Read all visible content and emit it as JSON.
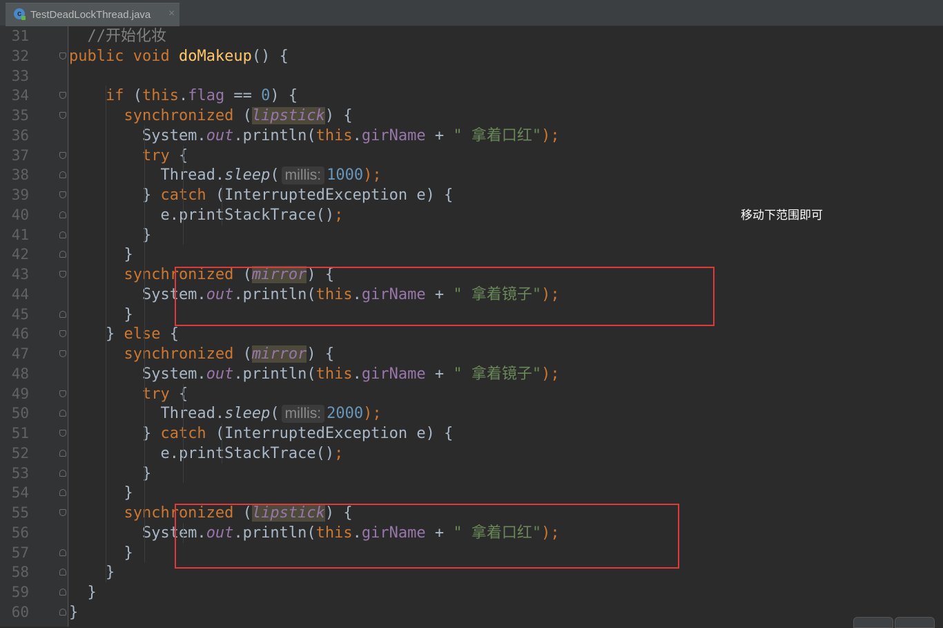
{
  "tab": {
    "filename": "TestDeadLockThread.java",
    "close_glyph": "×",
    "icon_letter": "c"
  },
  "annotation": "移动下范围即可",
  "lines": [
    {
      "n": "31",
      "parts": [
        [
          "  //开始化妆",
          "cmt"
        ]
      ]
    },
    {
      "n": "32",
      "parts": [
        [
          "public ",
          "kw"
        ],
        [
          "void ",
          "kw"
        ],
        [
          "doMakeup",
          "fn"
        ],
        [
          "() {",
          ""
        ]
      ]
    },
    {
      "n": "33",
      "parts": []
    },
    {
      "n": "34",
      "parts": [
        [
          "    if ",
          "kw"
        ],
        [
          "(",
          ""
        ],
        [
          "this",
          "kw"
        ],
        [
          ".",
          ""
        ],
        [
          "flag",
          "fld"
        ],
        [
          " == ",
          ""
        ],
        [
          "0",
          "num"
        ],
        [
          ") {",
          ""
        ]
      ]
    },
    {
      "n": "35",
      "parts": [
        [
          "      synchronized ",
          "kw"
        ],
        [
          "(",
          ""
        ],
        [
          "lipstick",
          "lock"
        ],
        [
          ") {",
          ""
        ]
      ]
    },
    {
      "n": "36",
      "parts": [
        [
          "        System.",
          ""
        ],
        [
          "out",
          "fld ital"
        ],
        [
          ".println(",
          ""
        ],
        [
          "this",
          "kw"
        ],
        [
          ".",
          ""
        ],
        [
          "girName",
          "fld"
        ],
        [
          " + ",
          ""
        ],
        [
          "\" 拿着口红\"",
          "str"
        ],
        [
          ");",
          "kw"
        ]
      ]
    },
    {
      "n": "37",
      "parts": [
        [
          "        try ",
          "kw"
        ],
        [
          "{",
          ""
        ]
      ]
    },
    {
      "n": "38",
      "parts": [
        [
          "          Thread.",
          ""
        ],
        [
          "sleep",
          "ital"
        ],
        [
          "(",
          ""
        ],
        [
          "millis:",
          "hint"
        ],
        [
          "1000",
          "num"
        ],
        [
          ");",
          "kw"
        ]
      ]
    },
    {
      "n": "39",
      "parts": [
        [
          "        } ",
          ""
        ],
        [
          "catch ",
          "kw"
        ],
        [
          "(InterruptedException e) {",
          ""
        ]
      ]
    },
    {
      "n": "40",
      "parts": [
        [
          "          e.printStackTrace()",
          ""
        ],
        [
          ";",
          "kw"
        ]
      ]
    },
    {
      "n": "41",
      "parts": [
        [
          "        }",
          ""
        ]
      ]
    },
    {
      "n": "42",
      "parts": [
        [
          "      }",
          ""
        ]
      ]
    },
    {
      "n": "43",
      "parts": [
        [
          "      synchronized ",
          "kw"
        ],
        [
          "(",
          ""
        ],
        [
          "mirror",
          "lock"
        ],
        [
          ") {",
          ""
        ]
      ]
    },
    {
      "n": "44",
      "parts": [
        [
          "        System.",
          ""
        ],
        [
          "out",
          "fld ital"
        ],
        [
          ".println(",
          ""
        ],
        [
          "this",
          "kw"
        ],
        [
          ".",
          ""
        ],
        [
          "girName",
          "fld"
        ],
        [
          " + ",
          ""
        ],
        [
          "\" 拿着镜子\"",
          "str"
        ],
        [
          ");",
          "kw"
        ]
      ]
    },
    {
      "n": "45",
      "parts": [
        [
          "      }",
          ""
        ]
      ]
    },
    {
      "n": "46",
      "parts": [
        [
          "    } ",
          ""
        ],
        [
          "else ",
          "kw"
        ],
        [
          "{",
          ""
        ]
      ]
    },
    {
      "n": "47",
      "parts": [
        [
          "      synchronized ",
          "kw"
        ],
        [
          "(",
          ""
        ],
        [
          "mirror",
          "lock"
        ],
        [
          ") {",
          ""
        ]
      ]
    },
    {
      "n": "48",
      "parts": [
        [
          "        System.",
          ""
        ],
        [
          "out",
          "fld ital"
        ],
        [
          ".println(",
          ""
        ],
        [
          "this",
          "kw"
        ],
        [
          ".",
          ""
        ],
        [
          "girName",
          "fld"
        ],
        [
          " + ",
          ""
        ],
        [
          "\" 拿着镜子\"",
          "str"
        ],
        [
          ");",
          "kw"
        ]
      ]
    },
    {
      "n": "49",
      "parts": [
        [
          "        try ",
          "kw"
        ],
        [
          "{",
          ""
        ]
      ]
    },
    {
      "n": "50",
      "parts": [
        [
          "          Thread.",
          ""
        ],
        [
          "sleep",
          "ital"
        ],
        [
          "(",
          ""
        ],
        [
          "millis:",
          "hint"
        ],
        [
          "2000",
          "num"
        ],
        [
          ");",
          "kw"
        ]
      ]
    },
    {
      "n": "51",
      "parts": [
        [
          "        } ",
          ""
        ],
        [
          "catch ",
          "kw"
        ],
        [
          "(InterruptedException e) {",
          ""
        ]
      ]
    },
    {
      "n": "52",
      "parts": [
        [
          "          e.printStackTrace()",
          ""
        ],
        [
          ";",
          "kw"
        ]
      ]
    },
    {
      "n": "53",
      "parts": [
        [
          "        }",
          ""
        ]
      ]
    },
    {
      "n": "54",
      "parts": [
        [
          "      }",
          ""
        ]
      ]
    },
    {
      "n": "55",
      "parts": [
        [
          "      synchronized ",
          "kw"
        ],
        [
          "(",
          ""
        ],
        [
          "lipstick",
          "lock"
        ],
        [
          ") {",
          ""
        ]
      ]
    },
    {
      "n": "56",
      "parts": [
        [
          "        System.",
          ""
        ],
        [
          "out",
          "fld ital"
        ],
        [
          ".println(",
          ""
        ],
        [
          "this",
          "kw"
        ],
        [
          ".",
          ""
        ],
        [
          "girName",
          "fld"
        ],
        [
          " + ",
          ""
        ],
        [
          "\" 拿着口红\"",
          "str"
        ],
        [
          ");",
          "kw"
        ]
      ]
    },
    {
      "n": "57",
      "parts": [
        [
          "      }",
          ""
        ]
      ]
    },
    {
      "n": "58",
      "parts": [
        [
          "    }",
          ""
        ]
      ]
    },
    {
      "n": "59",
      "parts": [
        [
          "  }",
          ""
        ]
      ]
    },
    {
      "n": "60",
      "parts": [
        [
          "}",
          ""
        ]
      ]
    }
  ],
  "colors": {
    "background": "#2b2b2b",
    "keyword": "#cc7832",
    "comment": "#808080",
    "method": "#ffc66d",
    "field": "#9876aa",
    "number": "#6897bb",
    "string": "#6a8759",
    "highlight_box": "#e0393c"
  }
}
